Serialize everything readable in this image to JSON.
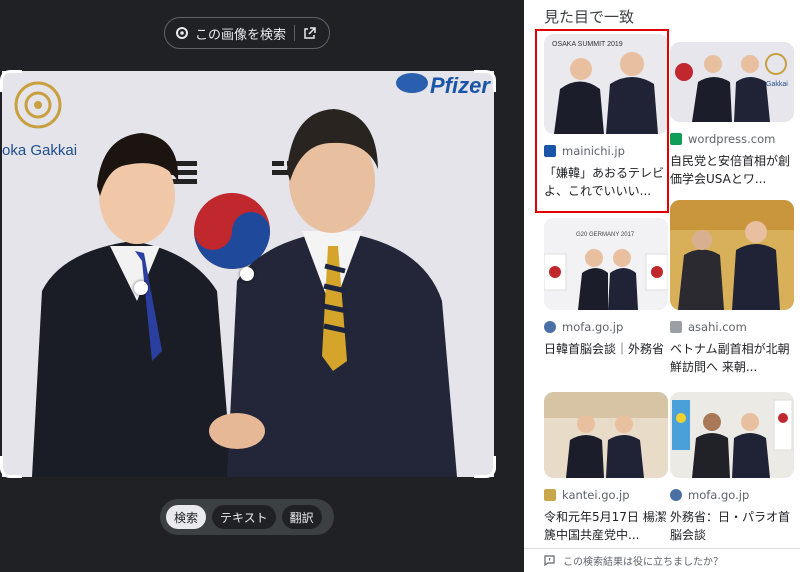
{
  "lens": {
    "search_label": "この画像を検索",
    "modes": [
      "検索",
      "テキスト",
      "翻訳"
    ],
    "photo": {
      "logo_left_text": "oka Gakkai",
      "logo_right_text": "Pfizer"
    }
  },
  "results": {
    "title": "見た目で一致",
    "items": [
      {
        "source": "mainichi.jp",
        "title": "「嫌韓」あおるテレビよ、これでいいい...",
        "fav_color": "#1a55a8",
        "thumb_text": "OSAKA SUMMIT 2019"
      },
      {
        "source": "wordpress.com",
        "title": "自民党と安倍首相が創価学会USAとワ...",
        "fav_color": "#0f9d58",
        "thumb_text": "Gakkai"
      },
      {
        "source": "mofa.go.jp",
        "title": "日韓首脳会談｜外務省",
        "fav_color": "#4a6fa5",
        "thumb_text": "G20 GERMANY 2017"
      },
      {
        "source": "asahi.com",
        "title": "ベトナム副首相が北朝鮮訪問へ 来朝...",
        "fav_color": "#9aa0a6",
        "thumb_text": ""
      },
      {
        "source": "kantei.go.jp",
        "title": "令和元年5月17日 楊潔篪中国共産党中...",
        "fav_color": "#c9a64a",
        "thumb_text": ""
      },
      {
        "source": "mofa.go.jp",
        "title": "外務省：日・パラオ首脳会談",
        "fav_color": "#4a6fa5",
        "thumb_text": ""
      }
    ],
    "feedback": "この検索結果は役に立ちましたか？"
  }
}
